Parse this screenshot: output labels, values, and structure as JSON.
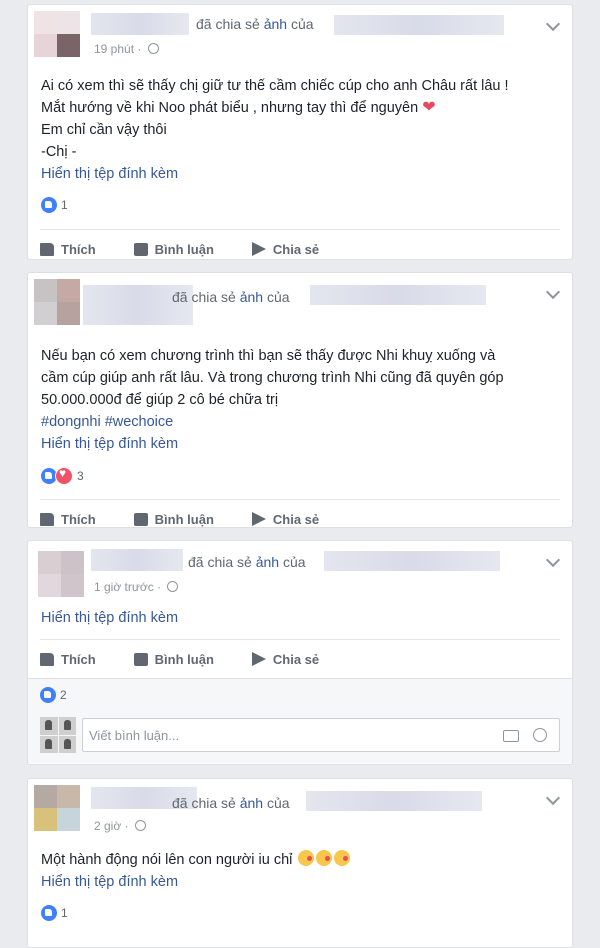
{
  "icons": {
    "like": "like-icon",
    "love": "love-icon",
    "comment": "comment-icon",
    "share": "share-icon",
    "camera": "camera-icon",
    "smile": "smile-icon",
    "globe": "globe-icon",
    "menu": "chevron-down-icon"
  },
  "colors": {
    "link": "#365899",
    "like_blue": "#4080ff",
    "love_red": "#f25268",
    "background": "#e9ebee"
  },
  "actions": {
    "like": "Thích",
    "comment": "Bình luận",
    "share": "Chia sẻ"
  },
  "posts": [
    {
      "shared_prefix": "đã chia sẻ",
      "shared_photo": "ảnh",
      "shared_of": "của",
      "time": "19 phút",
      "lines": [
        "Ai có xem thì sẽ thấy chị giữ tư thế cầm chiếc cúp cho anh Châu rất lâu !",
        "Mắt hướng về khi Noo phát biểu , nhưng tay thì để nguyên",
        "Em chỉ cần vậy thôi",
        "-Chị -"
      ],
      "attachment": "Hiển thị tệp đính kèm",
      "reaction_count": "1"
    },
    {
      "shared_prefix": "đã chia sẻ",
      "shared_photo": "ảnh",
      "shared_of": "của",
      "lines": [
        "Nếu bạn có xem chương trình thì bạn sẽ thấy được Nhi khuỵ xuống và",
        "cầm cúp giúp anh rất lâu. Và trong chương trình Nhi cũng đã quyên góp",
        "50.000.000đ để giúp 2 cô bé chữa trị"
      ],
      "hashtags": "#dongnhi #wechoice",
      "attachment": "Hiển thị tệp đính kèm",
      "reaction_count": "3"
    },
    {
      "shared_prefix": "đã chia sẻ",
      "shared_photo": "ảnh",
      "shared_of": "của",
      "time": "1 giờ trước",
      "attachment": "Hiển thị tệp đính kèm",
      "reaction_count": "2",
      "comment_placeholder": "Viết bình luận..."
    },
    {
      "shared_prefix": "đã chia sẻ",
      "shared_photo": "ảnh",
      "shared_of": "của",
      "time": "2 giờ",
      "lines": [
        "Một hành động nói lên con người iu chỉ"
      ],
      "attachment": "Hiển thị tệp đính kèm",
      "reaction_count": "1"
    }
  ]
}
